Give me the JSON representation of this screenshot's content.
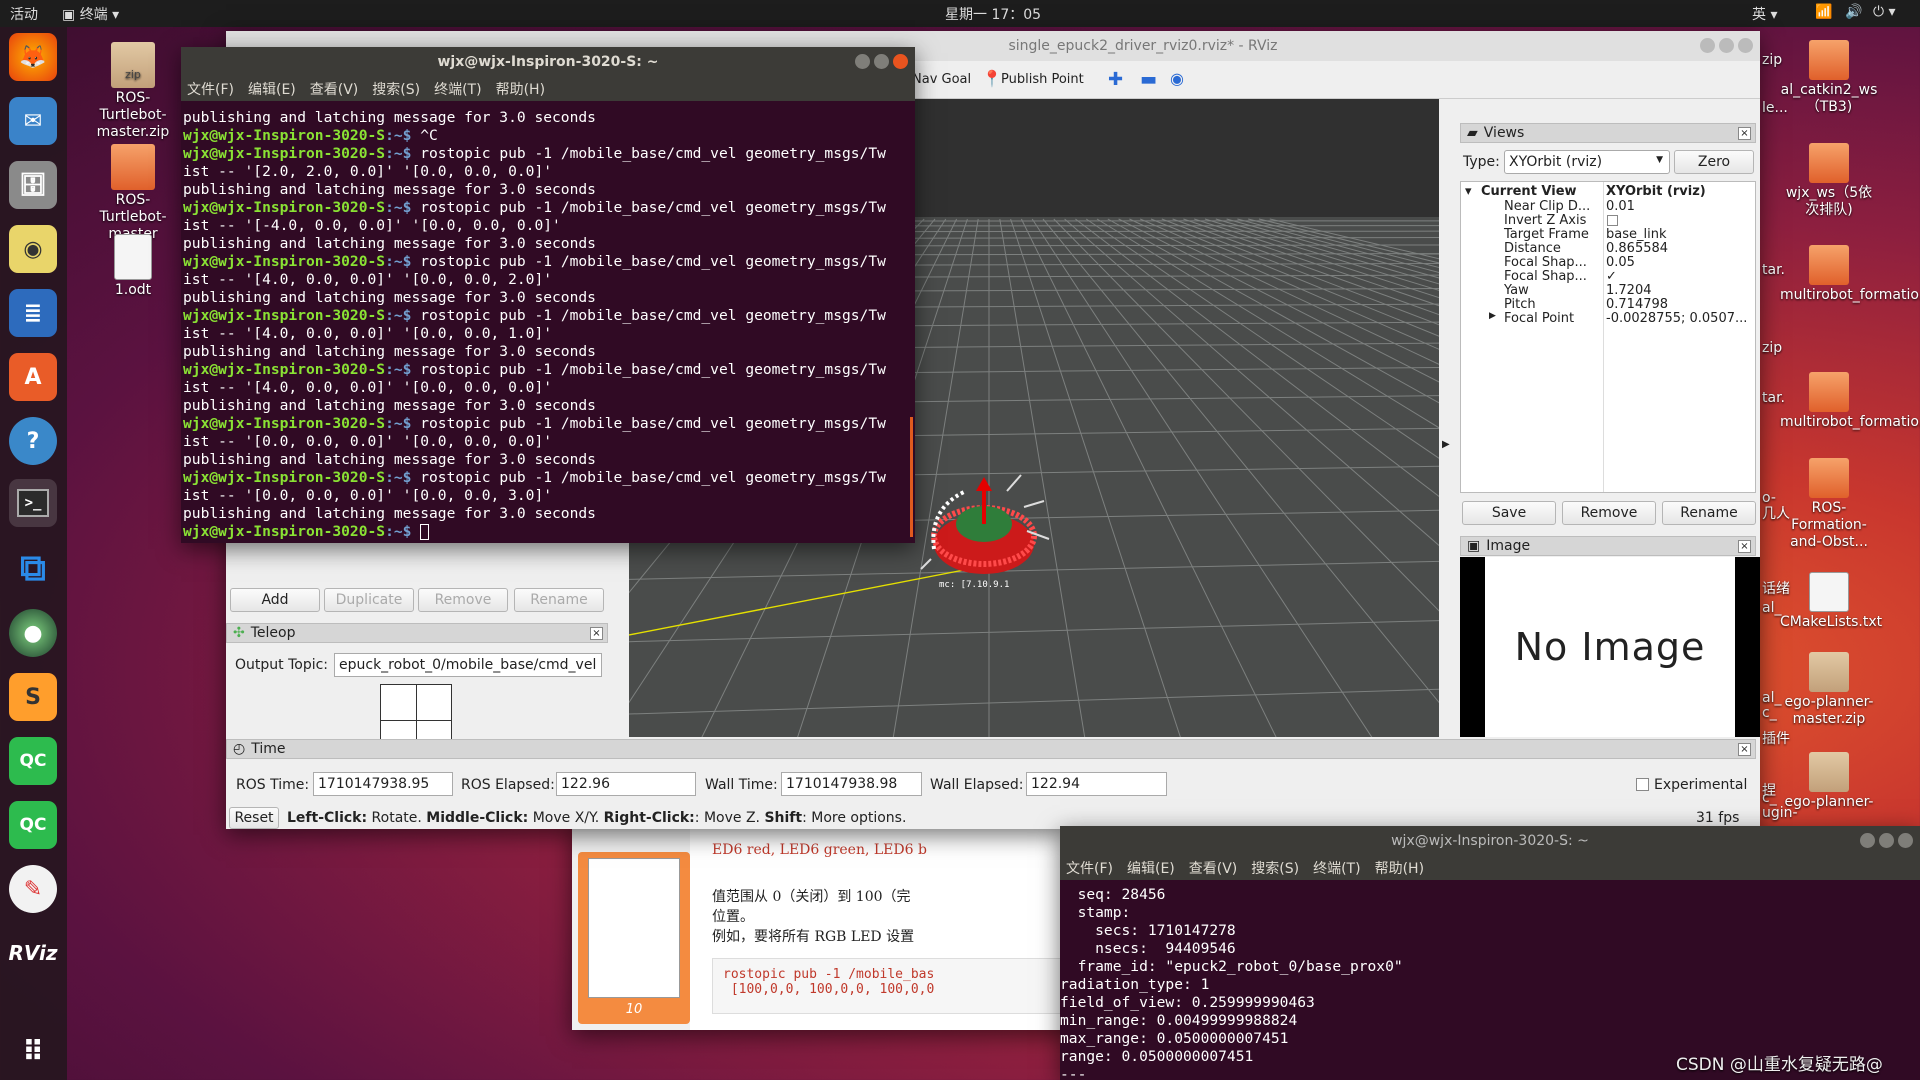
{
  "topbar": {
    "activities": "活动",
    "app_menu": "终端",
    "clock": "星期一 17：05",
    "input_method": "英"
  },
  "dock": {
    "items": [
      "firefox",
      "thunderbird",
      "files",
      "rhythmbox",
      "writer",
      "software",
      "help",
      "terminal",
      "vscode",
      "camera",
      "sublime",
      "qc",
      "qc",
      "xournal",
      "rviz",
      "apps"
    ],
    "qc_label": "QC",
    "rviz_label": "RViz"
  },
  "desktop": {
    "icons": [
      "ROS-Turtlebot-master.zip",
      "ROS-Turtlebot-master",
      "1.odt"
    ],
    "zip_badge": "zip",
    "right_icons": [
      "al_catkin2_ws（TB3)",
      "wjx_ws（5依次排队)",
      "multirobot_formatio...",
      "multirobot_formatio...",
      "ROS-Formation-and-Obst...",
      "CMakeLists.txt",
      "ego-planner-master.zip",
      "ego-planner-"
    ],
    "right_partial": [
      "zip",
      "le...",
      "tar.",
      "zip",
      "tar.",
      "o-",
      "几人",
      "话绪",
      "al_",
      "al_",
      "c_",
      "插件",
      "捏",
      "c_",
      "ugin-"
    ]
  },
  "terminal1": {
    "title": "wjx@wjx-Inspiron-3020-S: ~",
    "menu": [
      "文件(F)",
      "编辑(E)",
      "查看(V)",
      "搜索(S)",
      "终端(T)",
      "帮助(H)"
    ],
    "prompt": "wjx@wjx-Inspiron-3020-S",
    "prompt_tail": ":~$",
    "lines": [
      {
        "t": "o",
        "text": "publishing and latching message for 3.0 seconds"
      },
      {
        "t": "p",
        "cmd": " ^C"
      },
      {
        "t": "p",
        "cmd": " rostopic pub -1 /mobile_base/cmd_vel geometry_msgs/Tw"
      },
      {
        "t": "o",
        "text": "ist -- '[2.0, 2.0, 0.0]' '[0.0, 0.0, 0.0]'"
      },
      {
        "t": "o",
        "text": "publishing and latching message for 3.0 seconds"
      },
      {
        "t": "p",
        "cmd": " rostopic pub -1 /mobile_base/cmd_vel geometry_msgs/Tw"
      },
      {
        "t": "o",
        "text": "ist -- '[-4.0, 0.0, 0.0]' '[0.0, 0.0, 0.0]'"
      },
      {
        "t": "o",
        "text": "publishing and latching message for 3.0 seconds"
      },
      {
        "t": "p",
        "cmd": " rostopic pub -1 /mobile_base/cmd_vel geometry_msgs/Tw"
      },
      {
        "t": "o",
        "text": "ist -- '[4.0, 0.0, 0.0]' '[0.0, 0.0, 2.0]'"
      },
      {
        "t": "o",
        "text": "publishing and latching message for 3.0 seconds"
      },
      {
        "t": "p",
        "cmd": " rostopic pub -1 /mobile_base/cmd_vel geometry_msgs/Tw"
      },
      {
        "t": "o",
        "text": "ist -- '[4.0, 0.0, 0.0]' '[0.0, 0.0, 1.0]'"
      },
      {
        "t": "o",
        "text": "publishing and latching message for 3.0 seconds"
      },
      {
        "t": "p",
        "cmd": " rostopic pub -1 /mobile_base/cmd_vel geometry_msgs/Tw"
      },
      {
        "t": "o",
        "text": "ist -- '[4.0, 0.0, 0.0]' '[0.0, 0.0, 0.0]'"
      },
      {
        "t": "o",
        "text": "publishing and latching message for 3.0 seconds"
      },
      {
        "t": "p",
        "cmd": " rostopic pub -1 /mobile_base/cmd_vel geometry_msgs/Tw"
      },
      {
        "t": "o",
        "text": "ist -- '[0.0, 0.0, 0.0]' '[0.0, 0.0, 0.0]'"
      },
      {
        "t": "o",
        "text": "publishing and latching message for 3.0 seconds"
      },
      {
        "t": "p",
        "cmd": " rostopic pub -1 /mobile_base/cmd_vel geometry_msgs/Tw"
      },
      {
        "t": "o",
        "text": "ist -- '[0.0, 0.0, 0.0]' '[0.0, 0.0, 3.0]'"
      },
      {
        "t": "o",
        "text": "publishing and latching message for 3.0 seconds"
      },
      {
        "t": "p",
        "cmd": " "
      }
    ]
  },
  "rviz": {
    "title": "single_epuck2_driver_rviz0.rviz* - RViz",
    "toolbar": {
      "nav_goal": "Nav Goal",
      "publish_point": "Publish Point"
    },
    "displays_buttons": {
      "add": "Add",
      "duplicate": "Duplicate",
      "remove": "Remove",
      "rename": "Rename"
    },
    "teleop": {
      "title": "Teleop",
      "output_topic_label": "Output Topic:",
      "output_topic": "epuck_robot_0/mobile_base/cmd_vel"
    },
    "viewport": {
      "label": "mc: [7.10.9.1"
    },
    "views": {
      "title": "Views",
      "type_label": "Type:",
      "type_value": "XYOrbit (rviz)",
      "zero": "Zero",
      "header": {
        "name": "Current View",
        "value": "XYOrbit (rviz)"
      },
      "props": [
        {
          "name": "Near Clip D...",
          "value": "0.01"
        },
        {
          "name": "Invert Z Axis",
          "value": ""
        },
        {
          "name": "Target Frame",
          "value": "base_link"
        },
        {
          "name": "Distance",
          "value": "0.865584"
        },
        {
          "name": "Focal Shap...",
          "value": "0.05"
        },
        {
          "name": "Focal Shap...",
          "value": "✓"
        },
        {
          "name": "Yaw",
          "value": "1.7204"
        },
        {
          "name": "Pitch",
          "value": "0.714798"
        },
        {
          "name": "Focal Point",
          "value": "-0.0028755; 0.0507..."
        }
      ],
      "save": "Save",
      "remove": "Remove",
      "rename": "Rename"
    },
    "image": {
      "title": "Image",
      "no_image": "No Image"
    },
    "time": {
      "title": "Time",
      "ros_time_label": "ROS Time:",
      "ros_time": "1710147938.95",
      "ros_elapsed_label": "ROS Elapsed:",
      "ros_elapsed": "122.96",
      "wall_time_label": "Wall Time:",
      "wall_time": "1710147938.98",
      "wall_elapsed_label": "Wall Elapsed:",
      "wall_elapsed": "122.94",
      "experimental": "Experimental"
    },
    "status": {
      "reset": "Reset",
      "left": "Left-Click:",
      "left_t": " Rotate. ",
      "middle": "Middle-Click:",
      "middle_t": " Move X/Y. ",
      "right": "Right-Click:",
      "right_t": ": Move Z. ",
      "shift": "Shift",
      "shift_t": ": More options.",
      "fps": "31 fps"
    }
  },
  "doc": {
    "page_num": "10",
    "lines": [
      "ED6 red, LED6 green, LED6 b",
      "值范围从 0（关闭）到 100（完",
      "位置。",
      "例如，要将所有 RGB LED 设置"
    ],
    "code": [
      "rostopic pub -1 /mobile_bas",
      " [100,0,0, 100,0,0, 100,0,0"
    ]
  },
  "terminal2": {
    "title": "wjx@wjx-Inspiron-3020-S: ~",
    "menu": [
      "文件(F)",
      "编辑(E)",
      "查看(V)",
      "搜索(S)",
      "终端(T)",
      "帮助(H)"
    ],
    "lines": [
      "  seq: 28456",
      "  stamp:",
      "    secs: 1710147278",
      "    nsecs:  94409546",
      "  frame_id: \"epuck2_robot_0/base_prox0\"",
      "radiation_type: 1",
      "field_of_view: 0.259999990463",
      "min_range: 0.00499999988824",
      "max_range: 0.0500000007451",
      "range: 0.0500000007451",
      "---"
    ]
  },
  "watermark": "CSDN @山重水复疑无路@"
}
